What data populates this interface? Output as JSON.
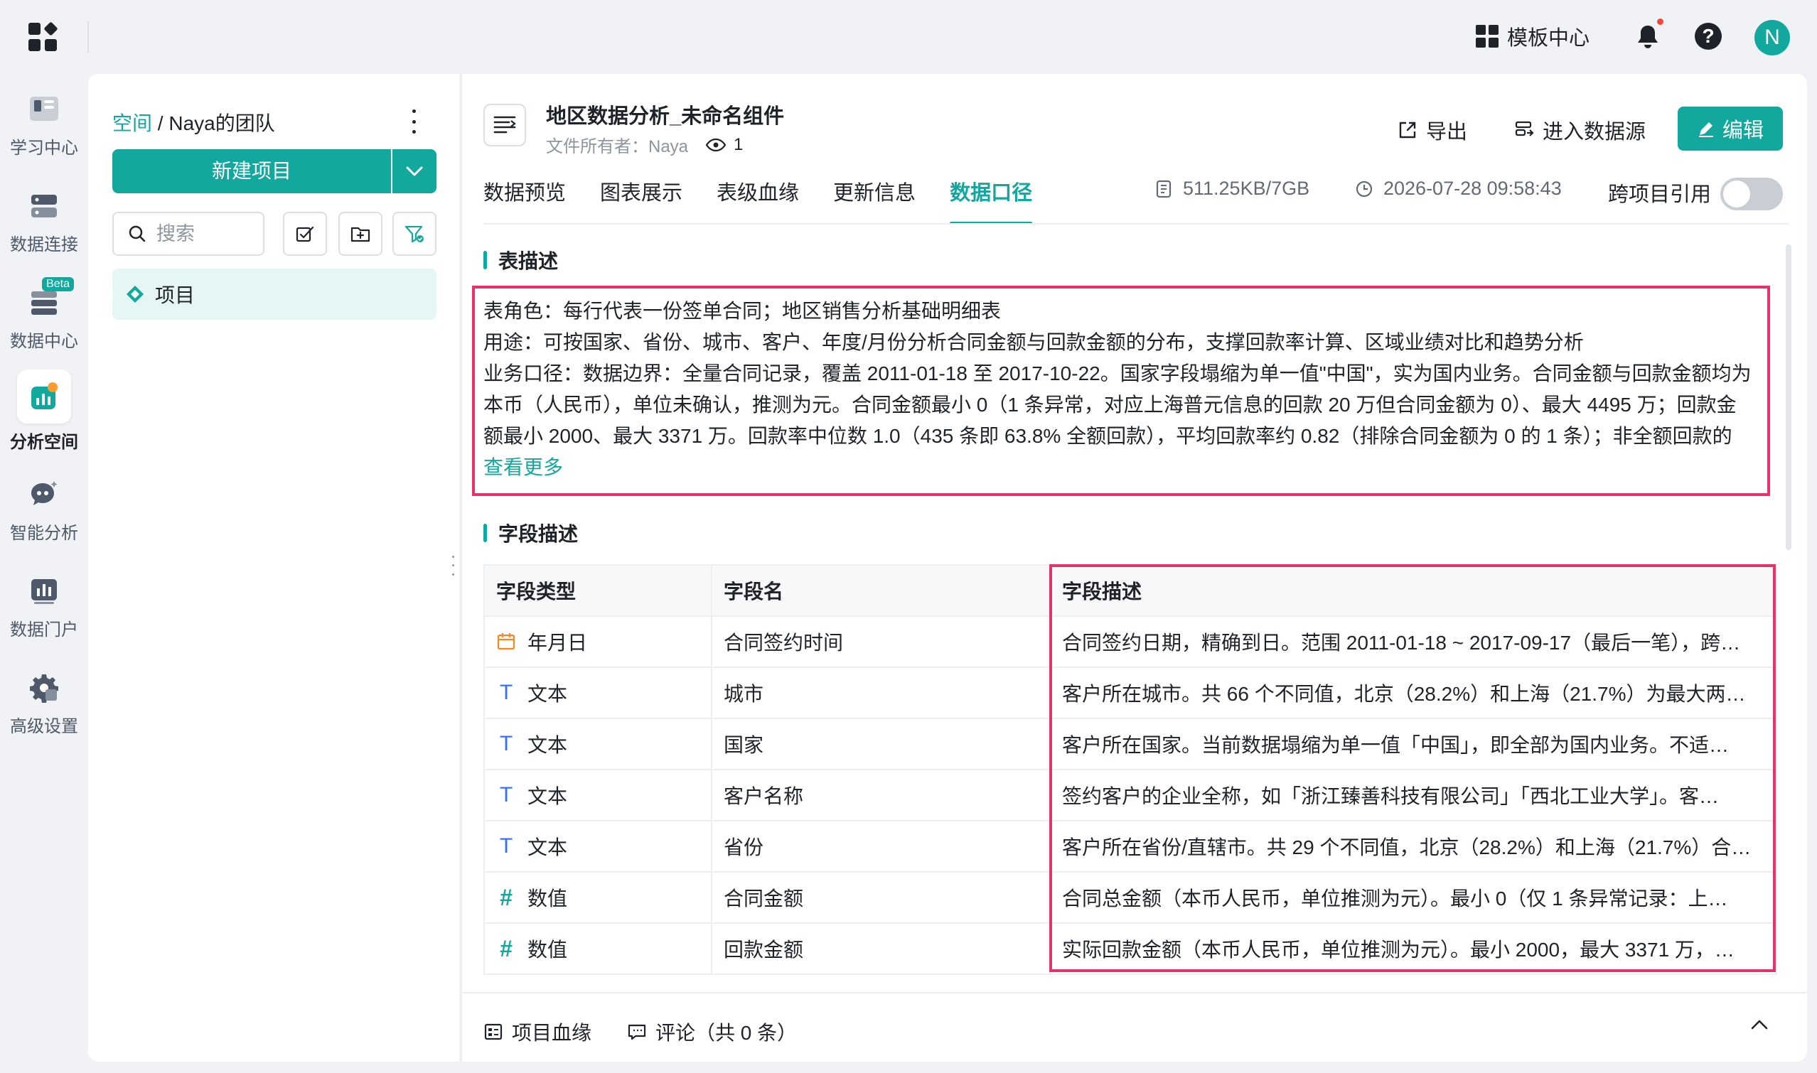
{
  "topbar": {
    "template_center": "模板中心",
    "avatar_letter": "N"
  },
  "nav": {
    "items": [
      {
        "label": "学习中心",
        "icon": "book-icon"
      },
      {
        "label": "数据连接",
        "icon": "database-connect-icon"
      },
      {
        "label": "数据中心",
        "icon": "data-center-icon",
        "badge": "Beta"
      },
      {
        "label": "分析空间",
        "icon": "analysis-space-icon",
        "active": true
      },
      {
        "label": "智能分析",
        "icon": "ai-analysis-icon"
      },
      {
        "label": "数据门户",
        "icon": "data-portal-icon"
      },
      {
        "label": "高级设置",
        "icon": "settings-gear-icon"
      }
    ]
  },
  "panel": {
    "breadcrumb_root": "空间",
    "breadcrumb_sep": " / ",
    "breadcrumb_team": "Naya的团队",
    "new_project": "新建项目",
    "search_placeholder": "搜索",
    "project_item": "项目"
  },
  "doc": {
    "title": "地区数据分析_未命名组件",
    "owner": "文件所有者：Naya",
    "views": "1",
    "export": "导出",
    "enter_source": "进入数据源",
    "edit": "编辑"
  },
  "tabs": [
    {
      "label": "数据预览"
    },
    {
      "label": "图表展示"
    },
    {
      "label": "表级血缘"
    },
    {
      "label": "更新信息"
    },
    {
      "label": "数据口径",
      "active": true
    }
  ],
  "tab_info": {
    "size": "511.25KB/7GB",
    "time": "2026-07-28 09:58:43",
    "cross_ref": "跨项目引用",
    "cross_ref_on": false
  },
  "table_desc": {
    "title": "表描述",
    "lines": [
      "表角色：每行代表一份签单合同；地区销售分析基础明细表",
      "用途：可按国家、省份、城市、客户、年度/月份分析合同金额与回款金额的分布，支撑回款率计算、区域业绩对比和趋势分析",
      "业务口径：数据边界：全量合同记录，覆盖 2011-01-18 至 2017-10-22。国家字段塌缩为单一值\"中国\"，实为国内业务。合同金额与回款金额均为",
      "本币（人民币），单位未确认，推测为元。合同金额最小 0（1 条异常，对应上海普元信息的回款 20 万但合同金额为 0）、最大 4495 万；回款金",
      "额最小 2000、最大 3371 万。回款率中位数 1.0（435 条即 63.8% 全额回款），平均回款率约 0.82（排除合同金额为 0 的 1 条）；非全额回款的"
    ],
    "more": "查看更多"
  },
  "field_desc": {
    "title": "字段描述",
    "headers": [
      "字段类型",
      "字段名",
      "字段描述"
    ],
    "rows": [
      {
        "icon": "calendar-icon",
        "type": "年月日",
        "name": "合同签约时间",
        "desc": "合同签约日期，精确到日。范围 2011-01-18 ~ 2017-09-17（最后一笔），跨…"
      },
      {
        "icon": "text-type-icon",
        "type": "文本",
        "name": "城市",
        "desc": "客户所在城市。共 66 个不同值，北京（28.2%）和上海（21.7%）为最大两…"
      },
      {
        "icon": "text-type-icon",
        "type": "文本",
        "name": "国家",
        "desc": "客户所在国家。当前数据塌缩为单一值「中国」，即全部为国内业务。不适…"
      },
      {
        "icon": "text-type-icon",
        "type": "文本",
        "name": "客户名称",
        "desc": "签约客户的企业全称，如「浙江臻善科技有限公司」「西北工业大学」。客…"
      },
      {
        "icon": "text-type-icon",
        "type": "文本",
        "name": "省份",
        "desc": "客户所在省份/直辖市。共 29 个不同值，北京（28.2%）和上海（21.7%）合…"
      },
      {
        "icon": "number-type-icon",
        "type": "数值",
        "name": "合同金额",
        "desc": "合同总金额（本币人民币，单位推测为元）。最小 0（仅 1 条异常记录：上…"
      },
      {
        "icon": "number-type-icon",
        "type": "数值",
        "name": "回款金额",
        "desc": "实际回款金额（本币人民币，单位推测为元）。最小 2000，最大 3371 万，…"
      }
    ]
  },
  "footer": {
    "lineage": "项目血缘",
    "comments": "评论（共 0 条）"
  },
  "colors": {
    "accent": "#13a89e",
    "highlight_border": "#e5336a"
  }
}
